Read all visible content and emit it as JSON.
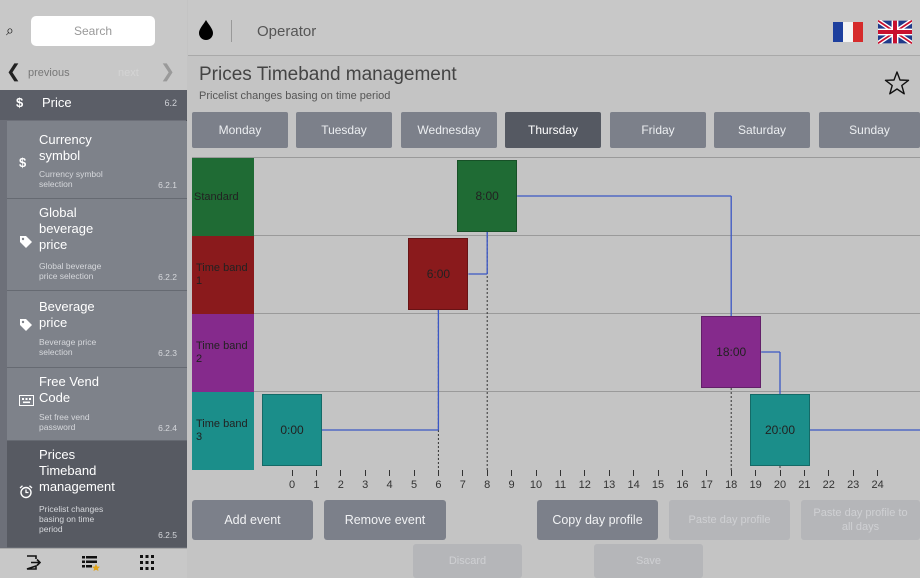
{
  "search": {
    "placeholder": "Search"
  },
  "nav": {
    "previous": "previous",
    "next": "next"
  },
  "section": {
    "icon": "$",
    "label": "Price",
    "number": "6.2"
  },
  "sidebar_items": [
    {
      "title_lines": [
        "Currency",
        "symbol"
      ],
      "sub_lines": [
        "Currency symbol",
        "selection"
      ],
      "number": "6.2.1",
      "icon": "dollar-icon"
    },
    {
      "title_lines": [
        "Global",
        "beverage",
        "price"
      ],
      "sub_lines": [
        "Global beverage",
        "price selection"
      ],
      "number": "6.2.2",
      "icon": "tag-icon"
    },
    {
      "title_lines": [
        "Beverage",
        "price"
      ],
      "sub_lines": [
        "Beverage price",
        "selection"
      ],
      "number": "6.2.3",
      "icon": "tag-icon"
    },
    {
      "title_lines": [
        "Free Vend",
        "Code"
      ],
      "sub_lines": [
        "Set free vend",
        "password"
      ],
      "number": "6.2.4",
      "icon": "keyboard-icon"
    },
    {
      "title_lines": [
        "Prices",
        "Timeband",
        "management"
      ],
      "sub_lines": [
        "Pricelist changes",
        "basing on time",
        "period"
      ],
      "number": "6.2.5",
      "icon": "alarm-clock-icon"
    }
  ],
  "topbar": {
    "operator": "Operator"
  },
  "page": {
    "title": "Prices Timeband management",
    "subtitle": "Pricelist changes basing on time period"
  },
  "days": [
    "Monday",
    "Tuesday",
    "Wednesday",
    "Thursday",
    "Friday",
    "Saturday",
    "Sunday"
  ],
  "selected_day": "Thursday",
  "rows": [
    {
      "label": "Standard",
      "color": "#1f6b34"
    },
    {
      "label": "Time band 1",
      "color": "#8a1a1c"
    },
    {
      "label": "Time band 2",
      "color": "#852a8c"
    },
    {
      "label": "Time band 3",
      "color": "#1b8e8a"
    }
  ],
  "events": [
    {
      "row": 3,
      "time": "0:00",
      "hour": 0
    },
    {
      "row": 1,
      "time": "6:00",
      "hour": 6
    },
    {
      "row": 0,
      "time": "8:00",
      "hour": 8
    },
    {
      "row": 2,
      "time": "18:00",
      "hour": 18
    },
    {
      "row": 3,
      "time": "20:00",
      "hour": 20
    }
  ],
  "hours": [
    "0",
    "1",
    "2",
    "3",
    "4",
    "5",
    "6",
    "7",
    "8",
    "9",
    "10",
    "11",
    "12",
    "13",
    "14",
    "15",
    "16",
    "17",
    "18",
    "19",
    "20",
    "21",
    "22",
    "23",
    "24"
  ],
  "buttons": {
    "add_event": "Add event",
    "remove_event": "Remove event",
    "copy_day_profile": "Copy day profile",
    "paste_day_profile": "Paste day profile",
    "paste_day_profile_all": "Paste day profile to all days",
    "discard": "Discard",
    "save": "Save"
  },
  "colors": {
    "accent_line": "#3b57c4",
    "day_selected": "#555962",
    "day_normal": "#7c808a"
  }
}
